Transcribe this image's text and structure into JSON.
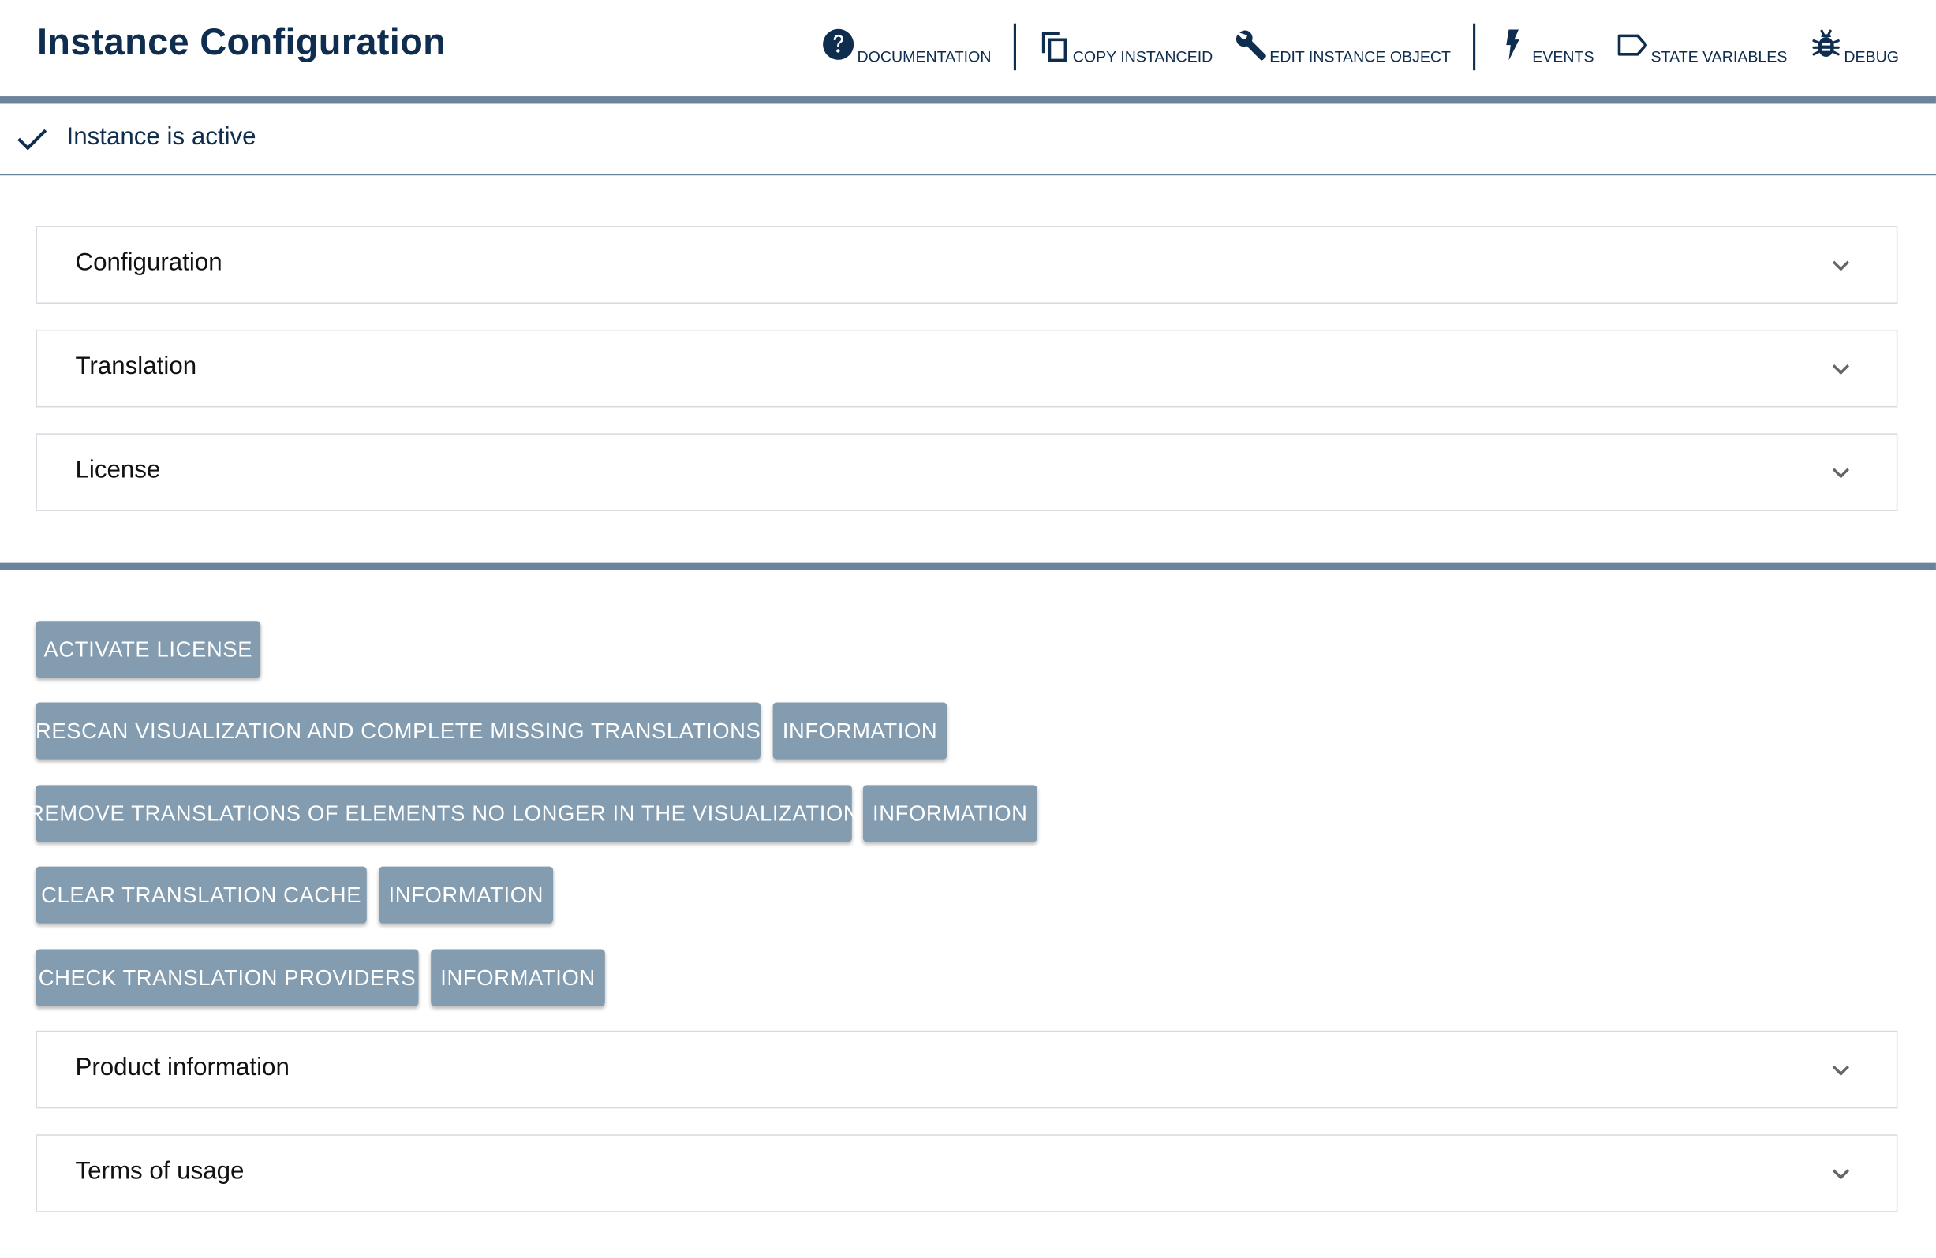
{
  "header": {
    "title": "Instance Configuration",
    "toolbar": [
      {
        "label": "DOCUMENTATION",
        "icon": "help-circle-icon"
      },
      {
        "label": "COPY INSTANCEID",
        "icon": "copy-icon"
      },
      {
        "label": "EDIT INSTANCE OBJECT",
        "icon": "wrench-icon"
      },
      {
        "label": "EVENTS",
        "icon": "lightning-icon"
      },
      {
        "label": "STATE VARIABLES",
        "icon": "tag-icon"
      },
      {
        "label": "DEBUG",
        "icon": "bug-icon"
      }
    ]
  },
  "status": {
    "icon": "check-icon",
    "text": "Instance is active"
  },
  "panels_top": [
    {
      "label": "Configuration"
    },
    {
      "label": "Translation"
    },
    {
      "label": "License"
    }
  ],
  "actions": {
    "activate_license": "ACTIVATE LICENSE",
    "rescan": "RESCAN VISUALIZATION AND COMPLETE MISSING TRANSLATIONS",
    "remove_translations": "REMOVE TRANSLATIONS OF ELEMENTS NO LONGER IN THE VISUALIZATION",
    "clear_cache": "CLEAR TRANSLATION CACHE",
    "check_providers": "CHECK TRANSLATION PROVIDERS",
    "information": "INFORMATION"
  },
  "panels_bottom": [
    {
      "label": "Product information"
    },
    {
      "label": "Terms of usage"
    }
  ],
  "colors": {
    "primary": "#0f2d4e",
    "button": "#849caf",
    "band": "#6b8499"
  }
}
